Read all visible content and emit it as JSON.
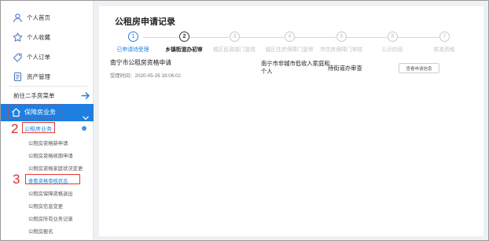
{
  "sidebar": {
    "items": [
      {
        "label": "个人首页",
        "icon": "user-icon"
      },
      {
        "label": "个人收藏",
        "icon": "star-icon"
      },
      {
        "label": "个人订单",
        "icon": "tag-icon"
      },
      {
        "label": "资产管理",
        "icon": "document-icon"
      }
    ],
    "goto_label": "前往二手房菜单",
    "active_section": "保障房业务",
    "sub_selected": "公租房业务",
    "sub_items": [
      "公租房资格新申请",
      "公租房资格续期申请",
      "公租房资格家庭状况变更",
      "查看资格审核状态",
      "公租房保障资格退出",
      "公租房信息变更",
      "公租房所有业务记录",
      "公租房报名"
    ]
  },
  "annotations": {
    "step2": "2",
    "step3": "3"
  },
  "main": {
    "title": "公租房申请记录",
    "steps": [
      {
        "num": "1",
        "label": "已申请待受理"
      },
      {
        "num": "2",
        "label": "乡镇街道办初审"
      },
      {
        "num": "3",
        "label": "城区民政部门复核"
      },
      {
        "num": "4",
        "label": "城区住房保障门复审"
      },
      {
        "num": "5",
        "label": "市住房保障门审核"
      },
      {
        "num": "6",
        "label": "公示阶段"
      },
      {
        "num": "7",
        "label": "核准资格"
      }
    ],
    "record": {
      "title": "南宁市公租房资格申请",
      "time": "受理时间：2020-05-26 18:06:02",
      "type": "南宁市非城市低收入家庭和个人",
      "status": "待街道办审查",
      "view_button": "查看申请信息"
    }
  },
  "colors": {
    "accent": "#1e7fe0",
    "annotation_red": "#e23a36"
  }
}
